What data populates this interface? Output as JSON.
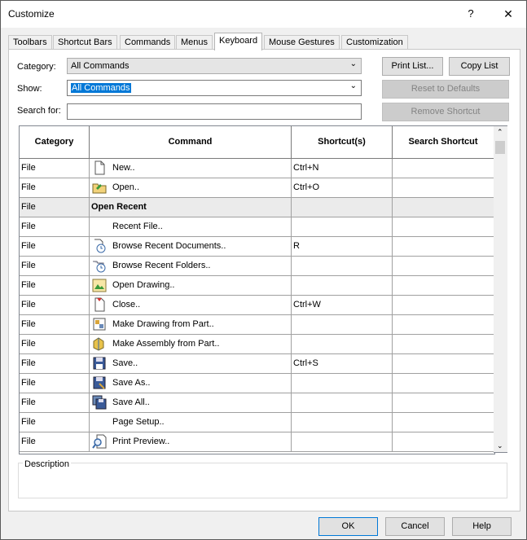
{
  "window": {
    "title": "Customize",
    "help_label": "?",
    "close_label": "✕"
  },
  "tabs": [
    {
      "label": "Toolbars",
      "active": false
    },
    {
      "label": "Shortcut Bars",
      "active": false
    },
    {
      "label": "Commands",
      "active": false
    },
    {
      "label": "Menus",
      "active": false
    },
    {
      "label": "Keyboard",
      "active": true
    },
    {
      "label": "Mouse Gestures",
      "active": false
    },
    {
      "label": "Customization",
      "active": false
    }
  ],
  "filters": {
    "category_label": "Category:",
    "category_value": "All Commands",
    "show_label": "Show:",
    "show_value": "All Commands",
    "search_label": "Search for:",
    "search_value": ""
  },
  "buttons": {
    "print_list": "Print List...",
    "copy_list": "Copy List",
    "reset_defaults": "Reset to Defaults",
    "remove_shortcut": "Remove Shortcut",
    "ok": "OK",
    "cancel": "Cancel",
    "help": "Help"
  },
  "table": {
    "headers": [
      "Category",
      "Command",
      "Shortcut(s)",
      "Search Shortcut"
    ],
    "rows": [
      {
        "category": "File",
        "command": "New..",
        "shortcut": "Ctrl+N",
        "search": "",
        "icon": "new-document-icon",
        "group": false
      },
      {
        "category": "File",
        "command": "Open..",
        "shortcut": "Ctrl+O",
        "search": "",
        "icon": "open-folder-icon",
        "group": false
      },
      {
        "category": "File",
        "command": "Open Recent",
        "shortcut": "",
        "search": "",
        "icon": "",
        "group": true
      },
      {
        "category": "File",
        "command": "Recent File..",
        "shortcut": "",
        "search": "",
        "icon": "",
        "group": false
      },
      {
        "category": "File",
        "command": "Browse Recent Documents..",
        "shortcut": "R",
        "search": "",
        "icon": "recent-documents-icon",
        "group": false
      },
      {
        "category": "File",
        "command": "Browse Recent Folders..",
        "shortcut": "",
        "search": "",
        "icon": "recent-folders-icon",
        "group": false
      },
      {
        "category": "File",
        "command": "Open Drawing..",
        "shortcut": "",
        "search": "",
        "icon": "open-drawing-icon",
        "group": false
      },
      {
        "category": "File",
        "command": "Close..",
        "shortcut": "Ctrl+W",
        "search": "",
        "icon": "close-document-icon",
        "group": false
      },
      {
        "category": "File",
        "command": "Make Drawing from Part..",
        "shortcut": "",
        "search": "",
        "icon": "make-drawing-icon",
        "group": false
      },
      {
        "category": "File",
        "command": "Make Assembly from Part..",
        "shortcut": "",
        "search": "",
        "icon": "make-assembly-icon",
        "group": false
      },
      {
        "category": "File",
        "command": "Save..",
        "shortcut": "Ctrl+S",
        "search": "",
        "icon": "save-icon",
        "group": false
      },
      {
        "category": "File",
        "command": "Save As..",
        "shortcut": "",
        "search": "",
        "icon": "save-as-icon",
        "group": false
      },
      {
        "category": "File",
        "command": "Save All..",
        "shortcut": "",
        "search": "",
        "icon": "save-all-icon",
        "group": false
      },
      {
        "category": "File",
        "command": "Page Setup..",
        "shortcut": "",
        "search": "",
        "icon": "",
        "group": false
      },
      {
        "category": "File",
        "command": "Print Preview..",
        "shortcut": "",
        "search": "",
        "icon": "print-preview-icon",
        "group": false
      }
    ]
  },
  "description": {
    "label": "Description",
    "text": ""
  },
  "colors": {
    "selection": "#0078d7",
    "group_row": "#ebebeb",
    "dialog_bg": "#f0f0f0"
  }
}
